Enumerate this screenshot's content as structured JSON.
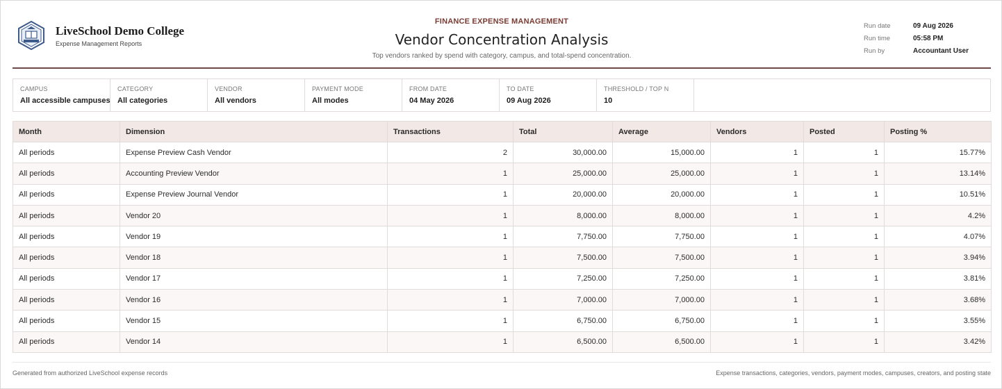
{
  "brand": {
    "college_name": "LiveSchool Demo College",
    "subtitle": "Expense Management Reports",
    "logo_icon": "school-crest-icon"
  },
  "report": {
    "eyebrow": "FINANCE EXPENSE MANAGEMENT",
    "title": "Vendor Concentration Analysis",
    "description": "Top vendors ranked by spend with category, campus, and total-spend concentration."
  },
  "meta": [
    {
      "label": "Run date",
      "value": "09 Aug 2026"
    },
    {
      "label": "Run time",
      "value": "05:58 PM"
    },
    {
      "label": "Run by",
      "value": "Accountant User"
    }
  ],
  "filters": [
    {
      "label": "Campus",
      "value": "All accessible campuses"
    },
    {
      "label": "Category",
      "value": "All categories"
    },
    {
      "label": "Vendor",
      "value": "All vendors"
    },
    {
      "label": "Payment mode",
      "value": "All modes"
    },
    {
      "label": "From date",
      "value": "04 May 2026"
    },
    {
      "label": "To date",
      "value": "09 Aug 2026"
    },
    {
      "label": "Threshold / Top N",
      "value": "10"
    }
  ],
  "table": {
    "columns": [
      "Month",
      "Dimension",
      "Transactions",
      "Total",
      "Average",
      "Vendors",
      "Posted",
      "Posting %"
    ],
    "rows": [
      [
        "All periods",
        "Expense Preview Cash Vendor",
        "2",
        "30,000.00",
        "15,000.00",
        "1",
        "1",
        "15.77%"
      ],
      [
        "All periods",
        "Accounting Preview Vendor",
        "1",
        "25,000.00",
        "25,000.00",
        "1",
        "1",
        "13.14%"
      ],
      [
        "All periods",
        "Expense Preview Journal Vendor",
        "1",
        "20,000.00",
        "20,000.00",
        "1",
        "1",
        "10.51%"
      ],
      [
        "All periods",
        "Vendor 20",
        "1",
        "8,000.00",
        "8,000.00",
        "1",
        "1",
        "4.2%"
      ],
      [
        "All periods",
        "Vendor 19",
        "1",
        "7,750.00",
        "7,750.00",
        "1",
        "1",
        "4.07%"
      ],
      [
        "All periods",
        "Vendor 18",
        "1",
        "7,500.00",
        "7,500.00",
        "1",
        "1",
        "3.94%"
      ],
      [
        "All periods",
        "Vendor 17",
        "1",
        "7,250.00",
        "7,250.00",
        "1",
        "1",
        "3.81%"
      ],
      [
        "All periods",
        "Vendor 16",
        "1",
        "7,000.00",
        "7,000.00",
        "1",
        "1",
        "3.68%"
      ],
      [
        "All periods",
        "Vendor 15",
        "1",
        "6,750.00",
        "6,750.00",
        "1",
        "1",
        "3.55%"
      ],
      [
        "All periods",
        "Vendor 14",
        "1",
        "6,500.00",
        "6,500.00",
        "1",
        "1",
        "3.42%"
      ]
    ]
  },
  "footer": {
    "left": "Generated from authorized LiveSchool expense records",
    "right": "Expense transactions, categories, vendors, payment modes, campuses, creators, and posting state"
  },
  "colors": {
    "accent": "#7a3b32",
    "rule": "#6b4a45",
    "header_bg": "#f2e8e5",
    "border": "#e1dcdb"
  }
}
